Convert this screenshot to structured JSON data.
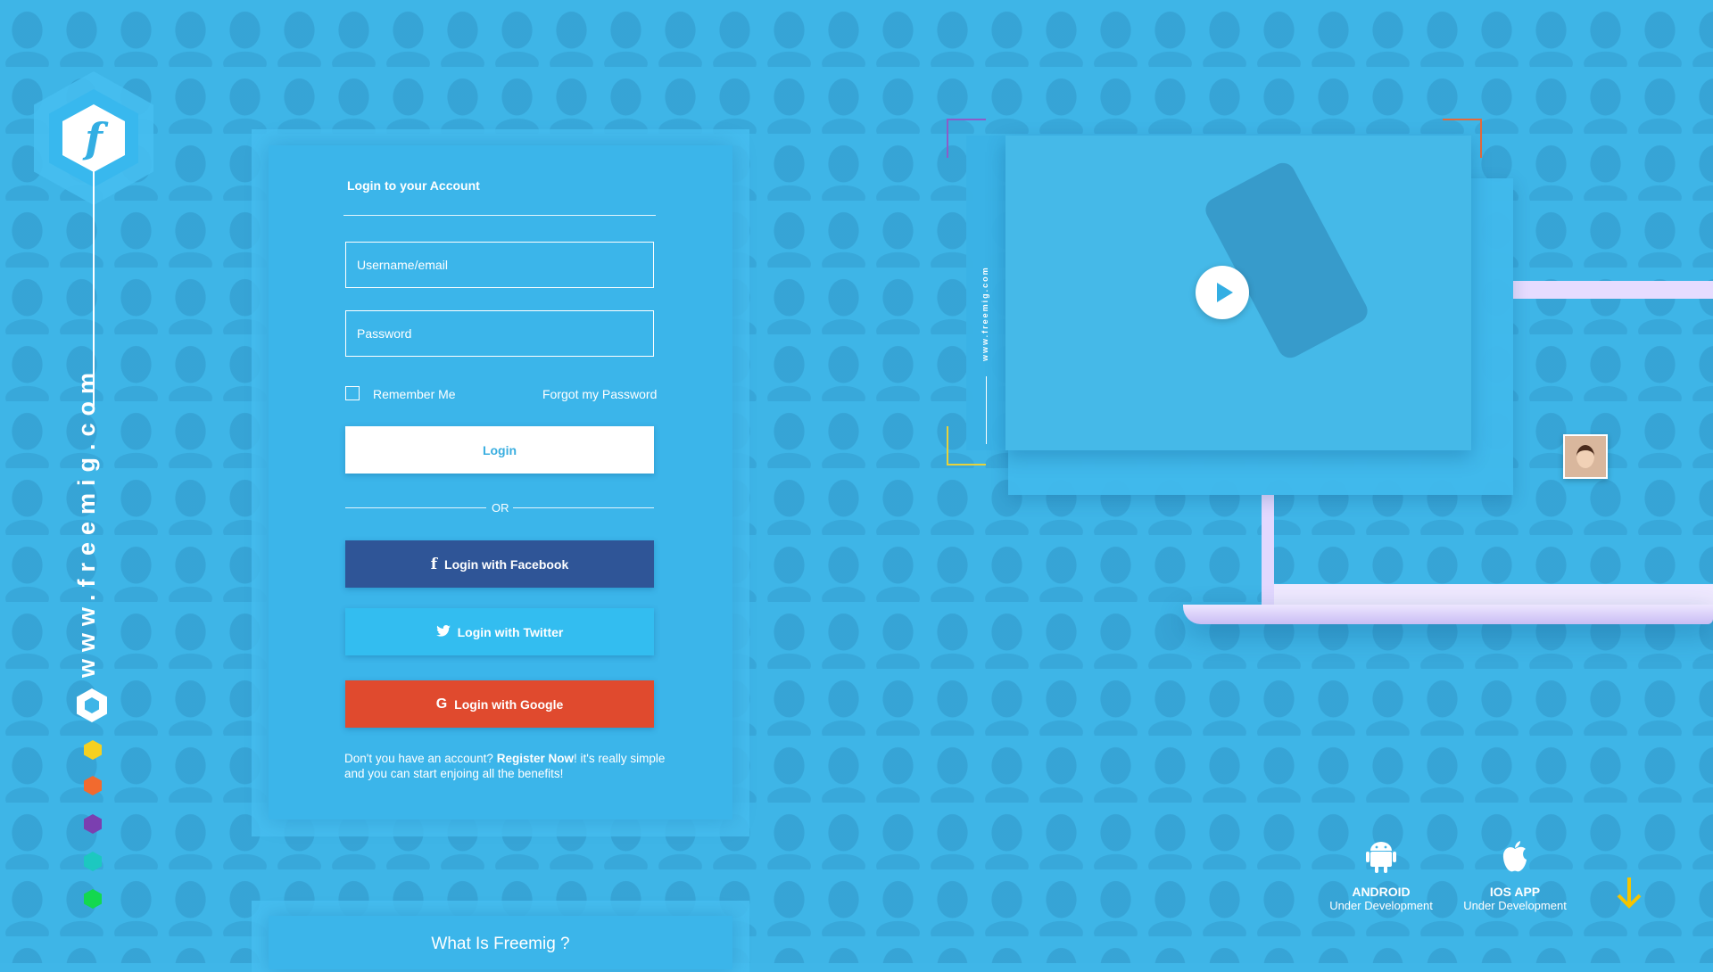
{
  "brand": {
    "url_vertical": "www.freemig.com",
    "logo_letter": "f",
    "accent_color": "#3bb5ea"
  },
  "rail_dots": [
    {
      "name": "yellow-hex-dot",
      "color": "#f5d020"
    },
    {
      "name": "orange-hex-dot",
      "color": "#f26a2e"
    },
    {
      "name": "purple-hex-dot",
      "color": "#7b3fb0"
    },
    {
      "name": "teal-hex-dot",
      "color": "#1cc8c0"
    },
    {
      "name": "green-hex-dot",
      "color": "#13d84f"
    }
  ],
  "login": {
    "title": "Login to your Account",
    "username_placeholder": "Username/email",
    "password_placeholder": "Password",
    "remember_label": "Remember Me",
    "forgot_label": "Forgot my Password",
    "login_button": "Login",
    "or_label": "OR",
    "facebook_button": "Login with Facebook",
    "twitter_button": "Login with Twitter",
    "google_button": "Login with Google",
    "register_prefix": "Don't you have an account? ",
    "register_link": "Register Now",
    "register_suffix": "! it's really simple and you can start enjoing all the benefits!"
  },
  "about": {
    "title": "What Is Freemig ?"
  },
  "video": {
    "side_url": "www.freemig.com"
  },
  "apps": {
    "android_name": "ANDROID",
    "android_status": "Under Development",
    "ios_name": "IOS APP",
    "ios_status": "Under Development"
  },
  "colors": {
    "facebook": "#2f5597",
    "twitter": "#33bdf0",
    "google": "#e04a2e",
    "scroll_arrow": "#f5c400"
  }
}
